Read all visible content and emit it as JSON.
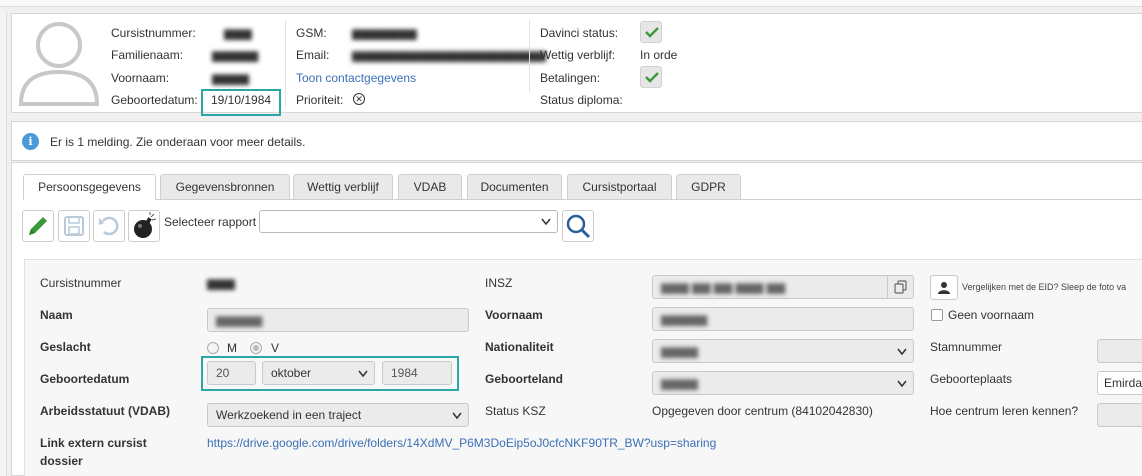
{
  "header": {
    "col1": {
      "labels": [
        "Cursistnummer:",
        "Familienaam:",
        "Voornaam:",
        "Geboortedatum:"
      ],
      "values": [
        "",
        "",
        "",
        "19/10/1984"
      ]
    },
    "col2": {
      "labels": [
        "GSM:",
        "Email:"
      ],
      "contact_link": "Toon contactgegevens",
      "priority_label": "Prioriteit:",
      "priority_icon": "circle-x-icon"
    },
    "col3": {
      "labels": [
        "Davinci status:",
        "Wettig verblijf:",
        "Betalingen:",
        "Status diploma:"
      ],
      "wettig_value": "In orde",
      "check_color": "#3a9a3a"
    }
  },
  "notification": {
    "text": "Er is 1 melding. Zie onderaan voor meer details.",
    "icon": "info-icon",
    "icon_color": "#4a9ad8"
  },
  "tabs": [
    "Persoonsgegevens",
    "Gegevensbronnen",
    "Wettig verblijf",
    "VDAB",
    "Documenten",
    "Cursistportaal",
    "GDPR"
  ],
  "active_tab": "Persoonsgegevens",
  "toolbar": {
    "rapport_label": "Selecteer rapport",
    "rapport_value": "",
    "edit_icon_color": "#3a9a3a"
  },
  "form": {
    "cursistnummer_label": "Cursistnummer",
    "naam_label": "Naam",
    "geslacht_label": "Geslacht",
    "geslacht_options": [
      "M",
      "V"
    ],
    "geslacht_selected": "V",
    "geboortedatum_label": "Geboortedatum",
    "geb_day": "20",
    "geb_month": "oktober",
    "geb_year": "1984",
    "arbeid_label": "Arbeidsstatuut (VDAB)",
    "arbeid_value": "Werkzoekend in een traject",
    "link_label_1": "Link extern cursist",
    "link_label_2": "dossier",
    "link_value": "https://drive.google.com/drive/folders/14XdMV_P6M3DoEip5oJ0cfcNKF90TR_BW?usp=sharing",
    "insz_label": "INSZ",
    "voornaam_label": "Voornaam",
    "nationaliteit_label": "Nationaliteit",
    "geboorteland_label": "Geboorteland",
    "status_ksz_label": "Status KSZ",
    "status_ksz_value": "Opgegeven door centrum (84102042830)",
    "eid_text": "Vergelijken met de EID? Sleep de foto va",
    "geen_voornaam_label": "Geen voornaam",
    "stamnummer_label": "Stamnummer",
    "geboorteplaats_label": "Geboorteplaats",
    "geboorteplaats_value": "Emirda",
    "centrum_label": "Hoe centrum leren kennen?"
  }
}
